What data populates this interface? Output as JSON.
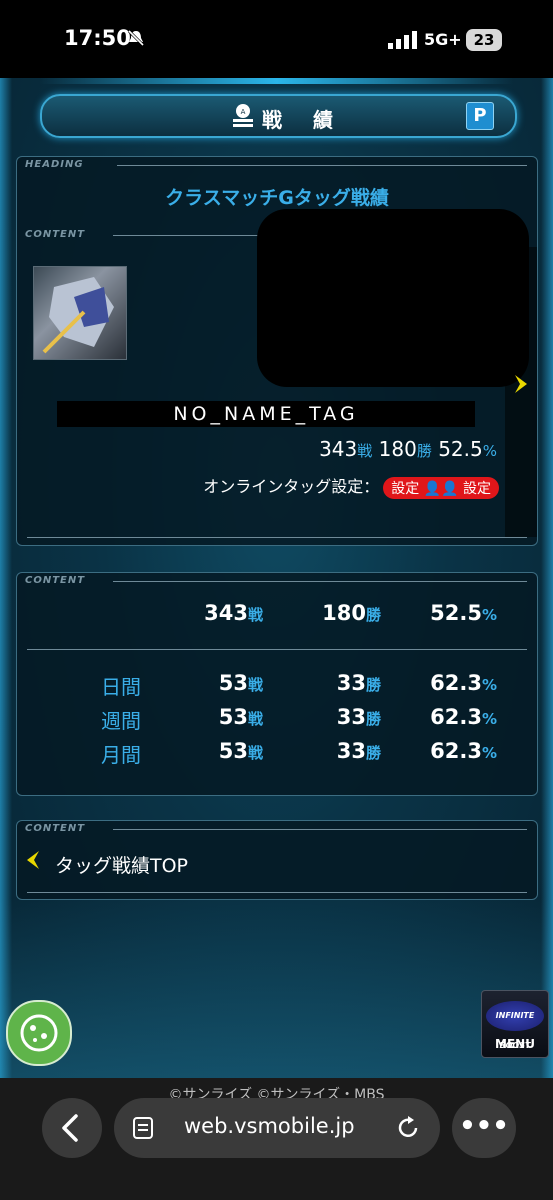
{
  "status_bar": {
    "time": "17:50",
    "network": "5G+",
    "battery": "23"
  },
  "header": {
    "title": "戦 績",
    "p_button_label": "P"
  },
  "profile_panel": {
    "heading_tag": "HEADING",
    "content_tag": "CONTENT",
    "heading_title": "クラスマッチGタッグ戦績",
    "name_tag": "NO_NAME_TAG",
    "battles": "343",
    "battles_unit": "戦",
    "wins": "180",
    "wins_unit": "勝",
    "rate": "52.5",
    "rate_unit": "%",
    "online_label": "オンラインタッグ設定：",
    "online_badge": "設定 👤👤 設定"
  },
  "stats_panel": {
    "content_tag": "CONTENT",
    "total": {
      "label": "",
      "battles": "343",
      "wins": "180",
      "rate": "52.5"
    },
    "rows": [
      {
        "label": "日間",
        "battles": "53",
        "wins": "33",
        "rate": "62.3"
      },
      {
        "label": "週間",
        "battles": "53",
        "wins": "33",
        "rate": "62.3"
      },
      {
        "label": "月間",
        "battles": "53",
        "wins": "33",
        "rate": "62.3"
      }
    ],
    "battles_unit": "戦",
    "wins_unit": "勝",
    "rate_unit": "%"
  },
  "nav_panel": {
    "content_tag": "CONTENT",
    "back_label": "タッグ戦績TOP"
  },
  "menu_button": {
    "logo_text": "INFINITE BOOST",
    "label": "MENU"
  },
  "browser": {
    "copyright": "©サンライズ ©サンライズ・MBS",
    "url": "web.vsmobile.jp",
    "more_label": "•••"
  },
  "colors": {
    "accent_blue": "#3aaee8",
    "badge_red": "#e0161a",
    "cookie_green": "#5fb44a"
  }
}
